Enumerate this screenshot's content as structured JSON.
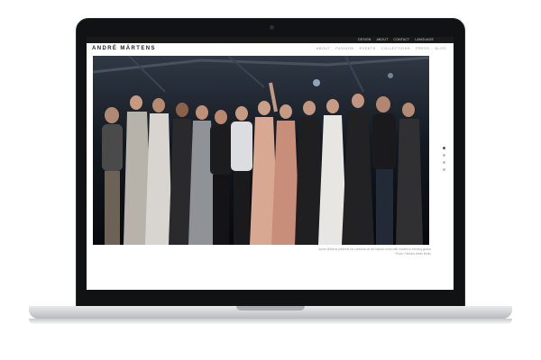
{
  "site": {
    "logo": "ANDRÉ MÄRTENS",
    "utility": [
      "DESIGN",
      "ABOUT",
      "CONTACT",
      "LANGUAGE"
    ],
    "nav": [
      "ABOUT",
      "FASHION",
      "EVENTS",
      "COLLECTIONS",
      "PRESS",
      "BLOG"
    ]
  },
  "slideshow": {
    "caption_line1": "André Märtens presents his collection at the fashion show with models in evening gowns",
    "caption_line2": "Photo: Fashion Week Berlin",
    "active_slide": 1,
    "slide_count": 4
  },
  "colors": {
    "header": "#1a1a1a",
    "bezel": "#111214",
    "accent": "#555555"
  }
}
